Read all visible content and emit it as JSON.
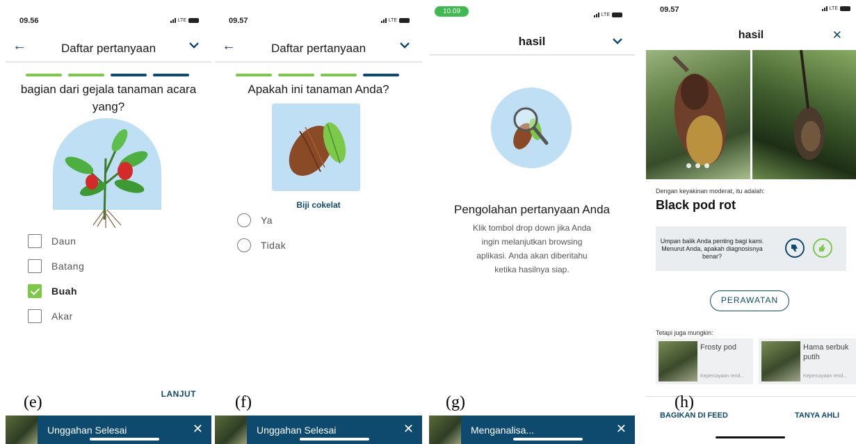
{
  "colors": {
    "brand": "#0d4a6e",
    "accent": "#7cc94a",
    "step_done": "#7cc94a",
    "step_todo": "#0d4a6e",
    "illustration_bg": "#bfe0f4"
  },
  "panel_e": {
    "caption": "(e)",
    "time": "09.56",
    "network": "LTE",
    "title": "Daftar pertanyaan",
    "steps": [
      "done",
      "done",
      "todo",
      "todo"
    ],
    "question": "bagian dari gejala tanaman acara yang?",
    "options": [
      {
        "label": "Daun",
        "checked": false
      },
      {
        "label": "Batang",
        "checked": false
      },
      {
        "label": "Buah",
        "checked": true
      },
      {
        "label": "Akar",
        "checked": false
      }
    ],
    "next_label": "LANJUT",
    "toast": "Unggahan Selesai"
  },
  "panel_f": {
    "caption": "(f)",
    "time": "09.57",
    "network": "LTE",
    "title": "Daftar pertanyaan",
    "steps": [
      "done",
      "done",
      "done",
      "todo"
    ],
    "question": "Apakah ini tanaman Anda?",
    "image_caption": "Biji cokelat",
    "options": [
      "Ya",
      "Tidak"
    ],
    "toast": "Unggahan Selesai"
  },
  "panel_g": {
    "caption": "(g)",
    "time": "10.09",
    "network": "LTE",
    "title": "hasil",
    "processing_title": "Pengolahan pertanyaan Anda",
    "processing_body": "Klik tombol drop down jika Anda ingin melanjutkan browsing aplikasi. Anda akan diberitahu ketika hasilnya siap.",
    "toast": "Menganalisa..."
  },
  "panel_h": {
    "caption": "(h)",
    "time": "09.57",
    "network": "LTE",
    "title": "hasil",
    "carousel_count": 3,
    "confidence_note": "Dengan keyakinan moderat, itu adalah:",
    "diagnosis": "Black pod rot",
    "feedback_text": "Umpan balik Anda penting bagi kami. Menurut Anda, apakah diagnosisnya benar?",
    "treatment_label": "PERAWATAN",
    "alternatives_title": "Tetapi juga mungkin:",
    "alternatives": [
      {
        "name": "Frosty pod",
        "confidence": "Kepercayaan rend..."
      },
      {
        "name": "Hama serbuk putih",
        "confidence": "Kepercayaan rend..."
      }
    ],
    "share_label": "BAGIKAN DI FEED",
    "ask_label": "TANYA AHLI"
  }
}
